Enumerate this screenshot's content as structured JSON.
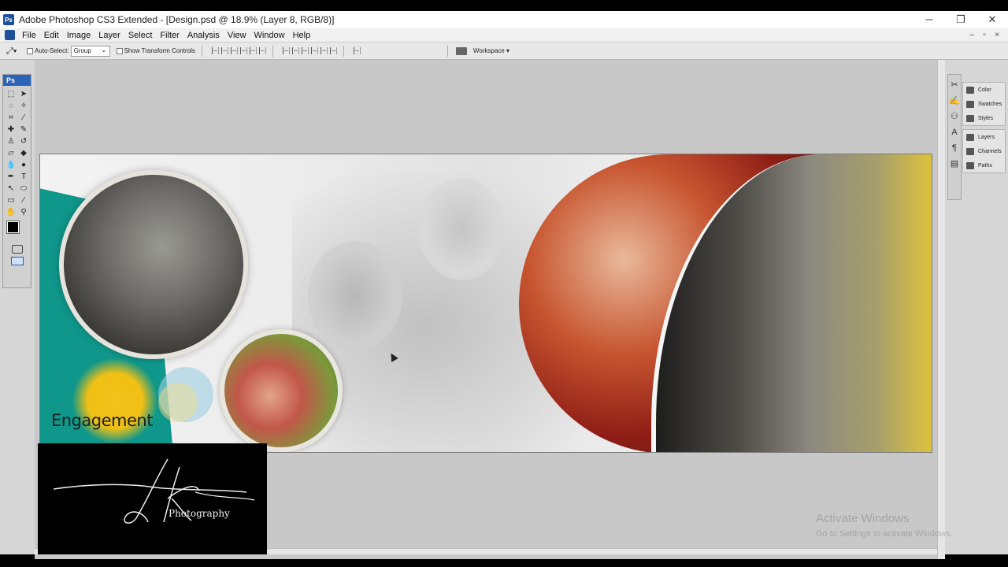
{
  "titlebar": {
    "badge": "Ps",
    "title": "Adobe Photoshop CS3 Extended - [Design.psd @ 18.9% (Layer 8, RGB/8)]",
    "minimize": "─",
    "maximize": "❐",
    "close": "✕"
  },
  "menu": [
    "File",
    "Edit",
    "Image",
    "Layer",
    "Select",
    "Filter",
    "Analysis",
    "View",
    "Window",
    "Help"
  ],
  "doc_controls": [
    "–",
    "▫",
    "×"
  ],
  "options": {
    "auto_select_label": "Auto-Select:",
    "auto_select_value": "Group",
    "show_transform_label": "Show Transform Controls",
    "workspace_label": "Workspace ▾"
  },
  "toolbox": {
    "logo": "Ps"
  },
  "panels": {
    "group1": [
      "Color",
      "Swatches",
      "Styles"
    ],
    "group2": [
      "Layers",
      "Channels",
      "Paths"
    ]
  },
  "design": {
    "headline": "Engagement"
  },
  "logo": {
    "tagline": "Photography"
  },
  "watermark": {
    "title": "Activate Windows",
    "subtitle": "Go to Settings to activate Windows."
  }
}
